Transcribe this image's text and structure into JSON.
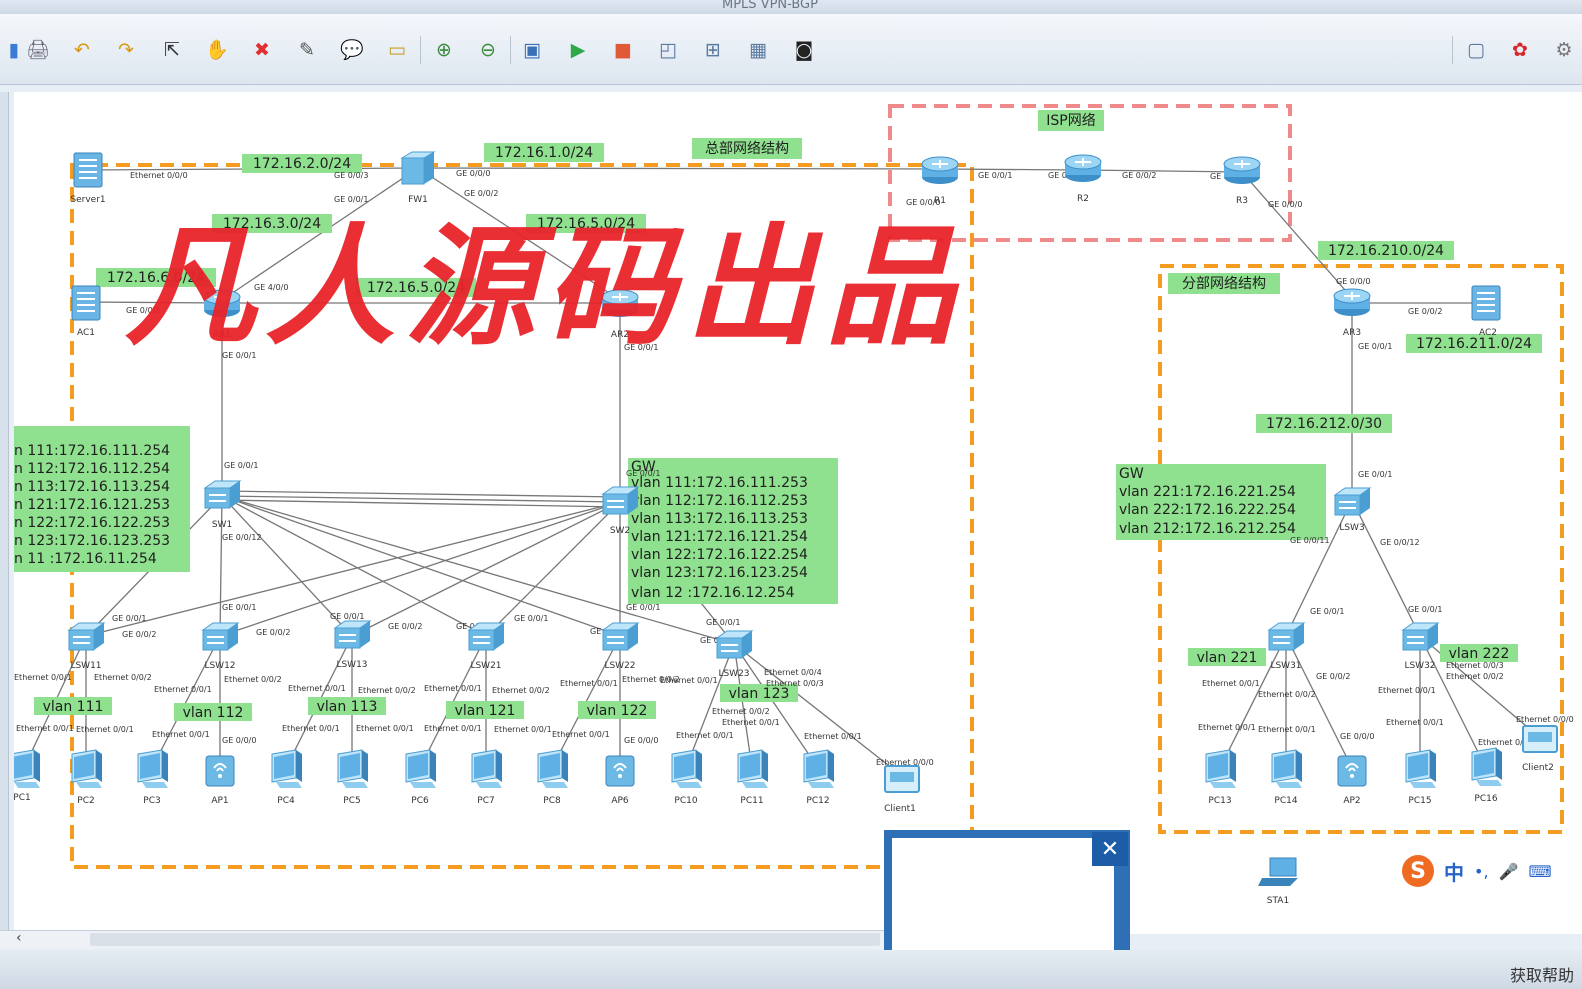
{
  "window": {
    "title": "MPLS VPN-BGP"
  },
  "toolbar": {
    "icons": [
      "save-icon",
      "undo-icon",
      "redo-icon",
      "select-icon",
      "pan-hand-icon",
      "delete-icon",
      "clear-icon",
      "text-label-icon",
      "rectangle-icon",
      "zoom-in-icon",
      "zoom-out-icon",
      "fit-icon",
      "start-device-icon",
      "stop-device-icon",
      "capture-icon",
      "topology-icon",
      "grid-icon",
      "console-icon",
      "chat-icon",
      "huawei-logo-icon",
      "settings-icon"
    ]
  },
  "watermark": {
    "text": "凡人源码出品"
  },
  "areas": {
    "hq": "总部网络结构",
    "isp": "ISP网络",
    "branch": "分部网络结构"
  },
  "subnets": [
    {
      "id": "s1",
      "text": "172.16.2.0/24"
    },
    {
      "id": "s2",
      "text": "172.16.1.0/24"
    },
    {
      "id": "s3",
      "text": "172.16.3.0/24"
    },
    {
      "id": "s4",
      "text": "172.16.5.0/24"
    },
    {
      "id": "s5",
      "text": "172.16.6.0/24"
    },
    {
      "id": "s6",
      "text": "172.16.5.0/24"
    },
    {
      "id": "s7",
      "text": "172.16.210.0/24"
    },
    {
      "id": "s8",
      "text": "172.16.211.0/24"
    },
    {
      "id": "s9",
      "text": "172.16.212.0/30"
    }
  ],
  "vlan_tags": [
    {
      "id": "v111",
      "text": "vlan 111"
    },
    {
      "id": "v112",
      "text": "vlan 112"
    },
    {
      "id": "v113",
      "text": "vlan 113"
    },
    {
      "id": "v121",
      "text": "vlan 121"
    },
    {
      "id": "v122",
      "text": "vlan 122"
    },
    {
      "id": "v123",
      "text": "vlan 123"
    },
    {
      "id": "v221",
      "text": "vlan 221"
    },
    {
      "id": "v222",
      "text": "vlan 222"
    }
  ],
  "gw_sw1": {
    "lines": [
      "n 111:172.16.111.254",
      "n 112:172.16.112.254",
      "n 113:172.16.113.254",
      "n 121:172.16.121.253",
      "n 122:172.16.122.253",
      "n 123:172.16.123.253",
      "n 11 :172.16.11.254"
    ]
  },
  "gw_sw2": {
    "header": "GW",
    "lines": [
      "vlan 111:172.16.111.253",
      "vlan 112:172.16.112.253",
      "vlan 113:172.16.113.253",
      "vlan 121:172.16.121.254",
      "vlan 122:172.16.122.254",
      "vlan 123:172.16.123.254",
      "vlan 12 :172.16.12.254"
    ]
  },
  "gw_branch": {
    "header": "GW",
    "lines": [
      "vlan 221:172.16.221.254",
      "vlan 222:172.16.222.254",
      "vlan 212:172.16.212.254"
    ]
  },
  "devices": {
    "Server1": "Server1",
    "FW1": "FW1",
    "AC1": "AC1",
    "AR1": "AR1",
    "AR2": "AR2",
    "R1": "R1",
    "R2": "R2",
    "R3": "R3",
    "AR3": "AR3",
    "AC2": "AC2",
    "SW1": "SW1",
    "SW2": "SW2",
    "LSW3": "LSW3",
    "LSW11": "LSW11",
    "LSW12": "LSW12",
    "LSW13": "LSW13",
    "LSW21": "LSW21",
    "LSW22": "LSW22",
    "LSW23": "LSW23",
    "LSW31": "LSW31",
    "LSW32": "LSW32",
    "PC1": "PC1",
    "PC2": "PC2",
    "PC3": "PC3",
    "AP1": "AP1",
    "PC4": "PC4",
    "PC5": "PC5",
    "PC6": "PC6",
    "PC7": "PC7",
    "PC8": "PC8",
    "AP6": "AP6",
    "PC10": "PC10",
    "PC11": "PC11",
    "PC12": "PC12",
    "Client1": "Client1",
    "PC13": "PC13",
    "PC14": "PC14",
    "AP2": "AP2",
    "PC15": "PC15",
    "PC16": "PC16",
    "Client2": "Client2",
    "STA1": "STA1"
  },
  "ports": {
    "eth000": "Ethernet 0/0/0",
    "eth001": "Ethernet 0/0/1",
    "eth002": "Ethernet 0/0/2",
    "eth003": "Ethernet 0/0/3",
    "eth004": "Ethernet 0/0/4",
    "ge000": "GE 0/0/0",
    "ge001": "GE 0/0/1",
    "ge002": "GE 0/0/2",
    "ge003": "GE 0/0/3",
    "ge0011": "GE 0/0/11",
    "ge0012": "GE 0/0/12",
    "ge400": "GE 4/0/0"
  },
  "ime": {
    "brand": "S",
    "mode": "中",
    "punct": "•,"
  },
  "status": {
    "help": "获取帮助"
  }
}
